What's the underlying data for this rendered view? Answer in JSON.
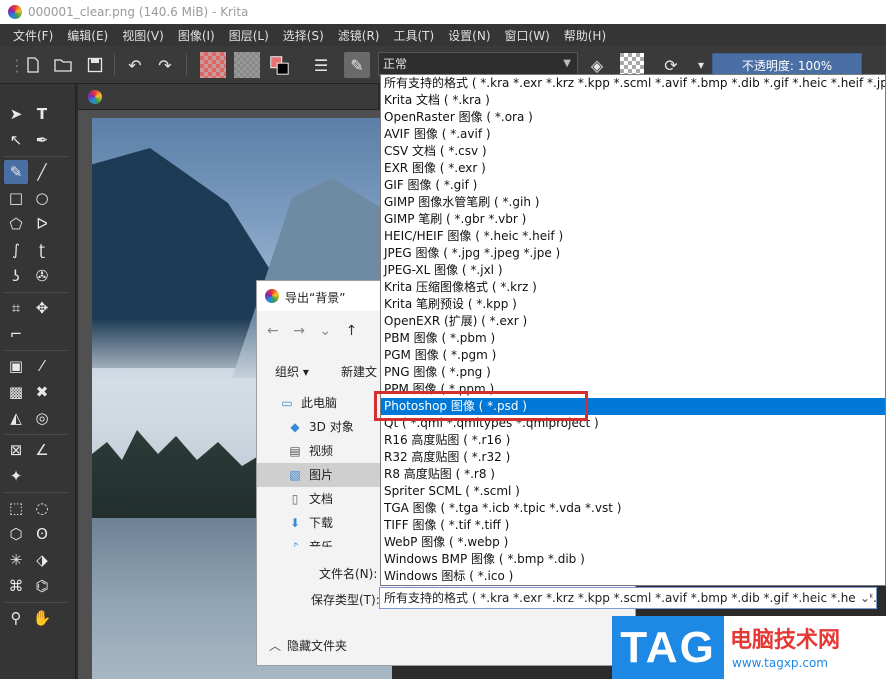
{
  "window": {
    "title": "000001_clear.png (140.6 MiB)  - Krita"
  },
  "menubar": {
    "items": [
      "文件(F)",
      "编辑(E)",
      "视图(V)",
      "图像(I)",
      "图层(L)",
      "选择(S)",
      "滤镜(R)",
      "工具(T)",
      "设置(N)",
      "窗口(W)",
      "帮助(H)"
    ]
  },
  "toolbar": {
    "blend_mode": "正常",
    "opacity_label": "不透明度:",
    "opacity_value": "100%"
  },
  "dialog": {
    "title": "导出“背景”",
    "organize": "组织 ▾",
    "new_folder": "新建文",
    "tree": [
      {
        "label": "此电脑",
        "icon": "computer-icon"
      },
      {
        "label": "3D 对象",
        "icon": "3d-objects-icon"
      },
      {
        "label": "视频",
        "icon": "video-icon"
      },
      {
        "label": "图片",
        "icon": "pictures-icon"
      },
      {
        "label": "文档",
        "icon": "documents-icon"
      },
      {
        "label": "下载",
        "icon": "download-icon"
      },
      {
        "label": "音乐",
        "icon": "music-icon"
      }
    ],
    "filename_label": "文件名(N):",
    "filetype_label": "保存类型(T):",
    "filetype_value": "所有支持的格式 ( *.kra *.exr *.krz *.kpp *.scml *.avif *.bmp *.dib *.gif *.heic *.heif *.jp",
    "hide_folders": "隐藏文件夹"
  },
  "filetype_options": [
    "所有支持的格式 ( *.kra *.exr *.krz *.kpp *.scml *.avif *.bmp *.dib *.gif *.heic *.heif *.jpg *.jp",
    "Krita 文档 ( *.kra )",
    "OpenRaster 图像 ( *.ora )",
    "AVIF 图像 ( *.avif )",
    "CSV 文档 ( *.csv )",
    "EXR 图像 ( *.exr )",
    "GIF 图像 ( *.gif )",
    "GIMP 图像水管笔刷 ( *.gih )",
    "GIMP 笔刷 ( *.gbr *.vbr )",
    "HEIC/HEIF 图像 ( *.heic *.heif )",
    "JPEG 图像 ( *.jpg *.jpeg *.jpe )",
    "JPEG-XL 图像 ( *.jxl )",
    "Krita 压缩图像格式 ( *.krz )",
    "Krita 笔刷预设 ( *.kpp )",
    "OpenEXR (扩展) ( *.exr )",
    "PBM 图像 ( *.pbm )",
    "PGM 图像 ( *.pgm )",
    "PNG 图像 ( *.png )",
    "PPM 图像 ( *.ppm )",
    "Photoshop 图像 ( *.psd )",
    "Qt ( *.qml *.qmltypes *.qmlproject )",
    "R16 高度贴图 ( *.r16 )",
    "R32 高度贴图 ( *.r32 )",
    "R8 高度贴图 ( *.r8 )",
    "Spriter SCML ( *.scml )",
    "TGA 图像 ( *.tga *.icb *.tpic *.vda *.vst )",
    "TIFF 图像 ( *.tif *.tiff )",
    "WebP 图像 ( *.webp )",
    "Windows BMP 图像 ( *.bmp *.dib )",
    "Windows 图标 ( *.ico )"
  ],
  "highlighted_index": 19,
  "watermark": {
    "logo": "TAG",
    "title": "电脑技术网",
    "url": "www.tagxp.com"
  },
  "colors": {
    "accent": "#0078d7",
    "highlight_border": "#d32f2f",
    "krita_active": "#4a6fa5"
  }
}
